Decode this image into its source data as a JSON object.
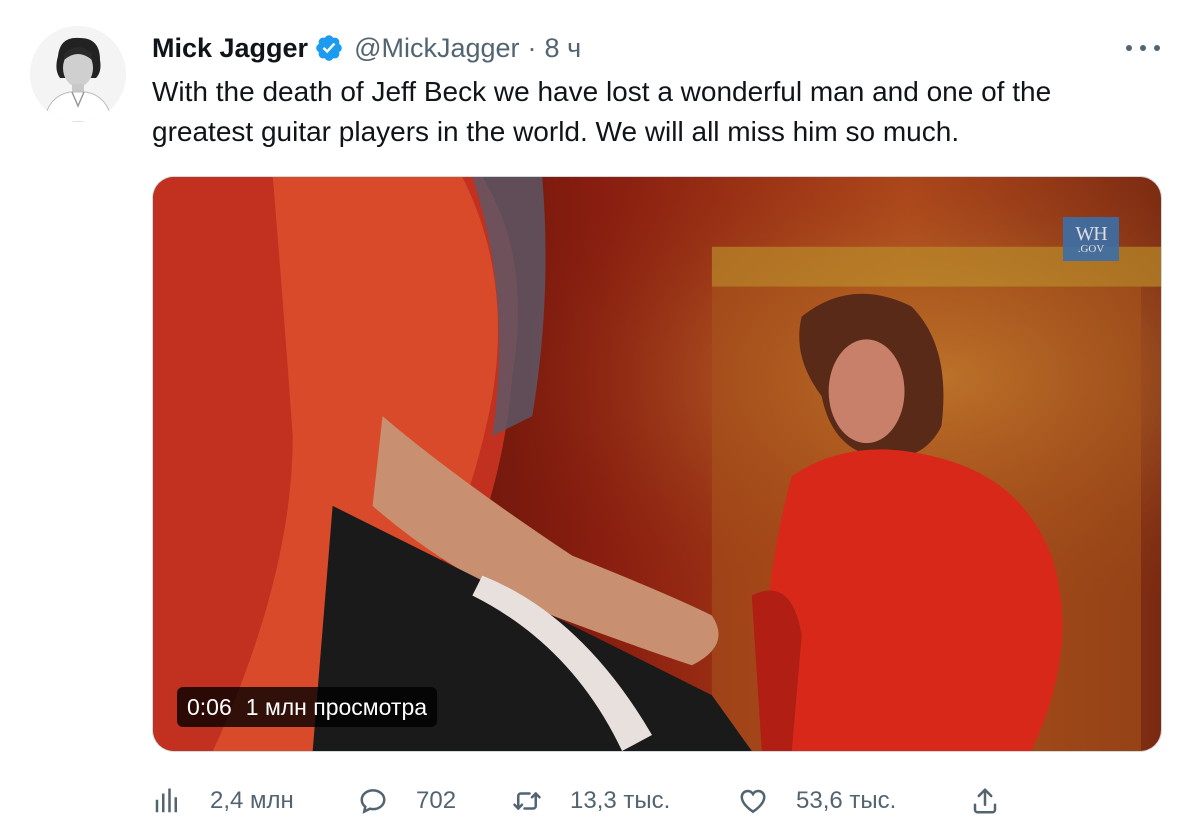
{
  "tweet": {
    "author_name": "Mick Jagger",
    "handle": "@MickJagger",
    "separator": "·",
    "time": "8 ч",
    "text": "With the death of Jeff Beck we have lost a wonderful man and one of the greatest guitar players in the world. We will all miss him so much."
  },
  "media": {
    "watermark_line1": "WH",
    "watermark_line2": ".GOV",
    "duration": "0:06",
    "views": "1 млн просмотра"
  },
  "actions": {
    "views_count": "2,4 млн",
    "reply_count": "702",
    "retweet_count": "13,3 тыс.",
    "like_count": "53,6 тыс."
  },
  "colors": {
    "text_primary": "#0f1419",
    "text_secondary": "#536471",
    "verified_blue": "#1d9bf0"
  },
  "icons": [
    "verified-badge-icon",
    "more-options-icon",
    "views-icon",
    "reply-icon",
    "retweet-icon",
    "like-icon",
    "share-icon"
  ]
}
